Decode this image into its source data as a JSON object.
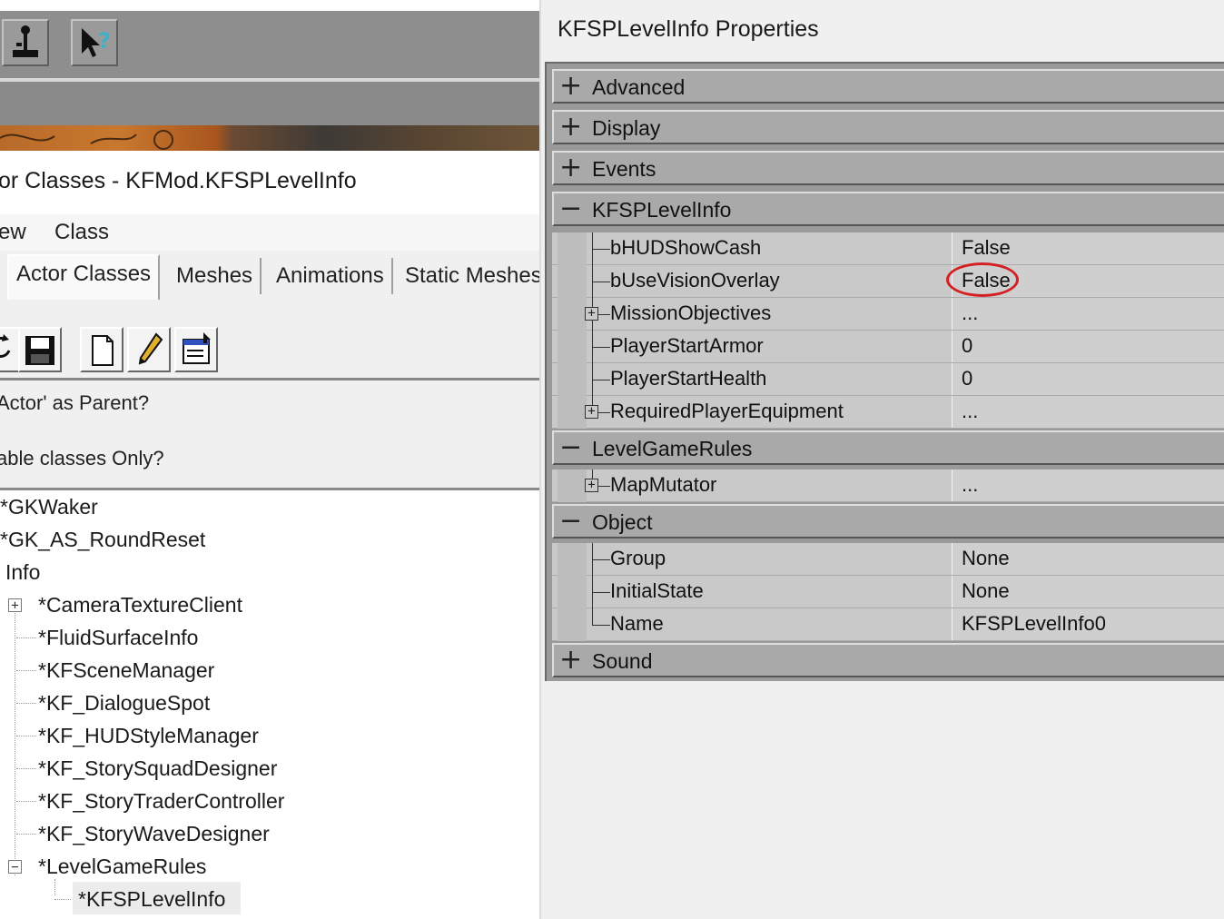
{
  "left_window": {
    "title": "or Classes - KFMod.KFSPLevelInfo",
    "menu": [
      "ew",
      "Class"
    ],
    "tabs": [
      "Actor Classes",
      "Meshes",
      "Animations",
      "Static Meshes"
    ],
    "options": [
      "Actor' as Parent?",
      "able classes Only?"
    ],
    "tree": {
      "top_items": [
        "*GKWaker",
        "*GK_AS_RoundReset",
        "Info"
      ],
      "info_children": [
        "*CameraTextureClient",
        "*FluidSurfaceInfo",
        "*KFSceneManager",
        "*KF_DialogueSpot",
        "*KF_HUDStyleManager",
        "*KF_StorySquadDesigner",
        "*KF_StoryTraderController",
        "*KF_StoryWaveDesigner",
        "*LevelGameRules"
      ],
      "selected": "*KFSPLevelInfo"
    }
  },
  "properties": {
    "title": "KFSPLevelInfo Properties",
    "categories": {
      "advanced": "Advanced",
      "display": "Display",
      "events": "Events",
      "kfsplevelinfo": "KFSPLevelInfo",
      "levelgamerules": "LevelGameRules",
      "object": "Object",
      "sound": "Sound"
    },
    "kfsplevelinfo_rows": [
      {
        "name": "bHUDShowCash",
        "value": "False"
      },
      {
        "name": "bUseVisionOverlay",
        "value": "False"
      },
      {
        "name": "MissionObjectives",
        "value": "..."
      },
      {
        "name": "PlayerStartArmor",
        "value": "0"
      },
      {
        "name": "PlayerStartHealth",
        "value": "0"
      },
      {
        "name": "RequiredPlayerEquipment",
        "value": "..."
      }
    ],
    "levelgamerules_rows": [
      {
        "name": "MapMutator",
        "value": "..."
      }
    ],
    "object_rows": [
      {
        "name": "Group",
        "value": "None"
      },
      {
        "name": "InitialState",
        "value": "None"
      },
      {
        "name": "Name",
        "value": "KFSPLevelInfo0"
      }
    ],
    "highlight_color": "#d42020"
  }
}
